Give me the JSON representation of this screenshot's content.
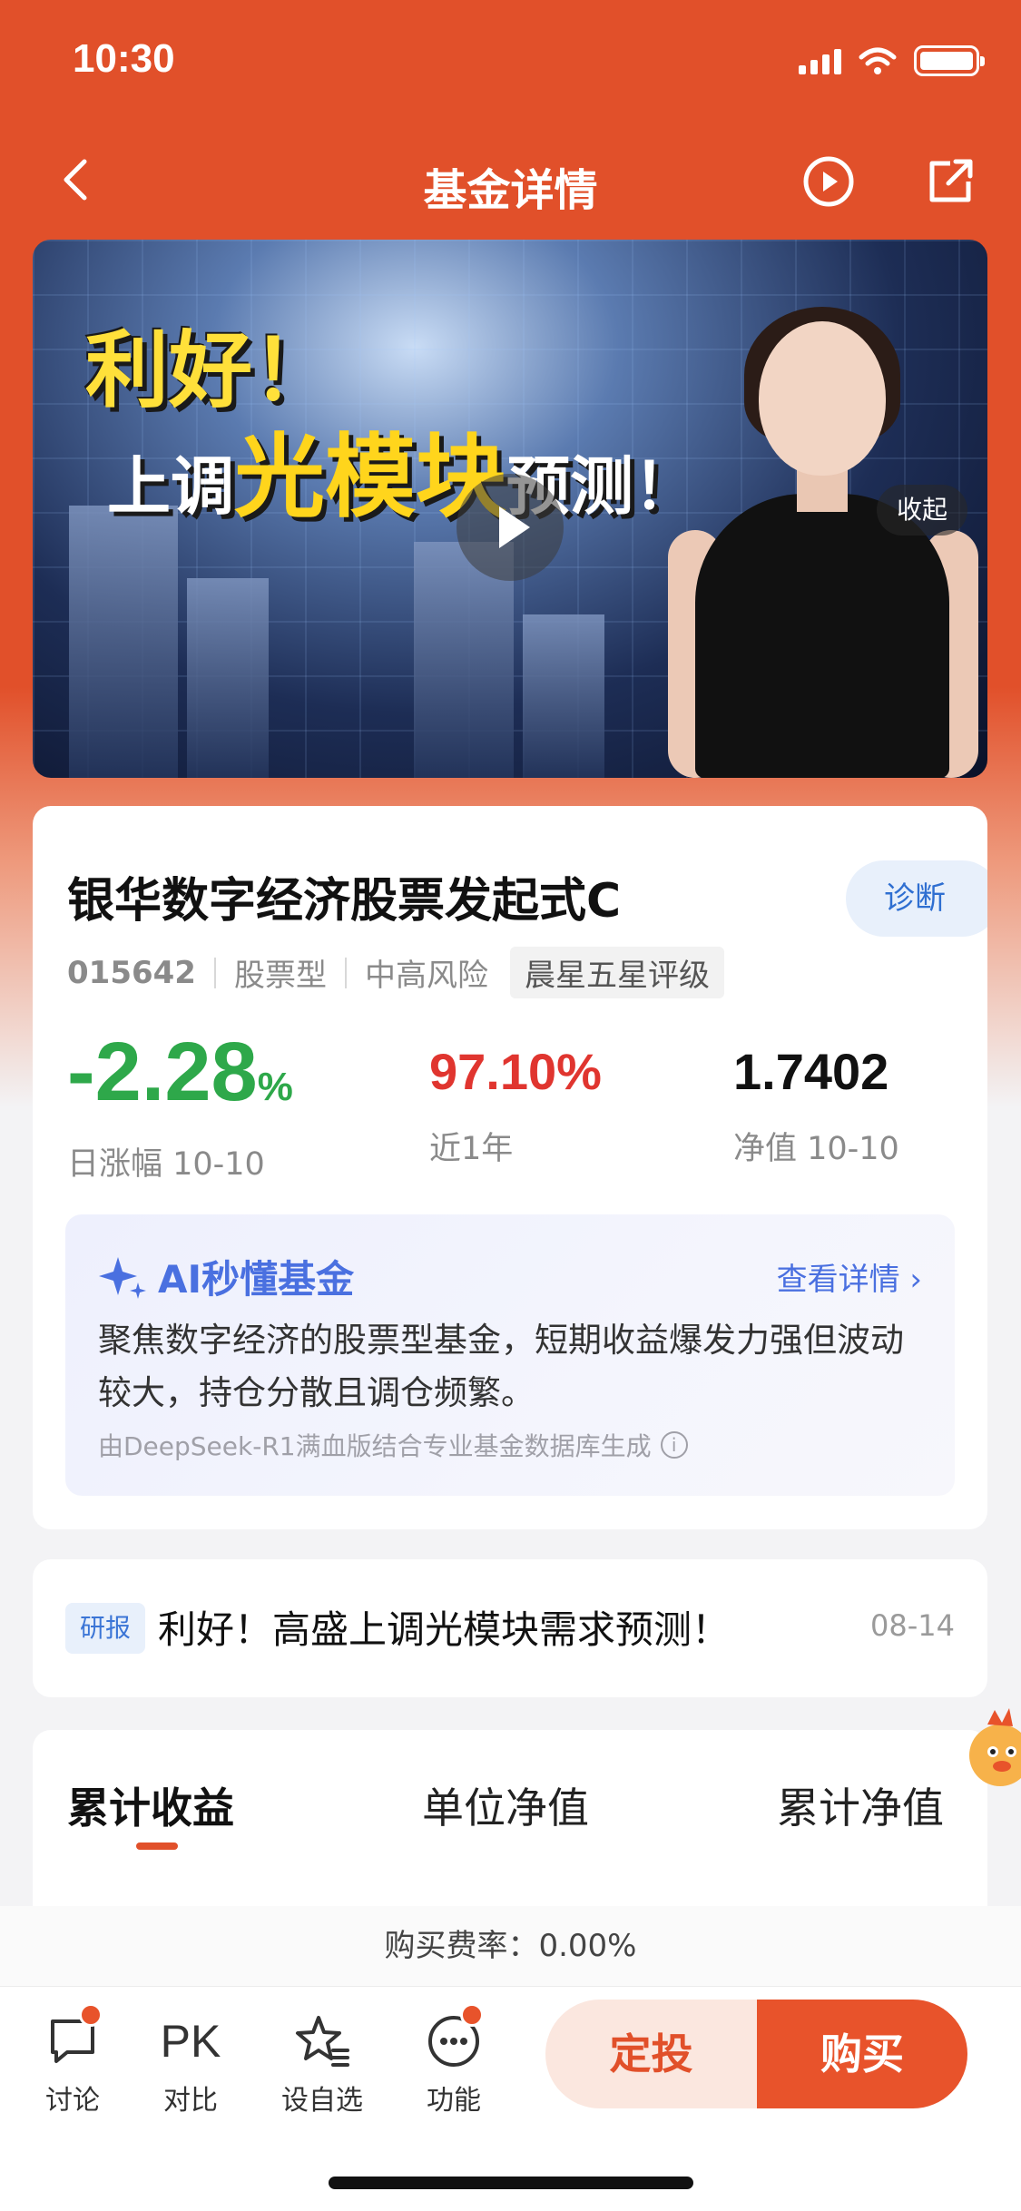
{
  "status_bar": {
    "time": "10:30"
  },
  "nav": {
    "title": "基金详情"
  },
  "video": {
    "headline_line1": "利好！",
    "headline_line2_pre": "上调",
    "headline_line2_highlight": "光模块",
    "headline_line2_post": "预测！",
    "collapse_label": "收起"
  },
  "fund": {
    "name": "银华数字经济股票发起式C",
    "diagnose_label": "诊断",
    "code": "015642",
    "type": "股票型",
    "risk": "中高风险",
    "rating": "晨星五星评级",
    "stats": [
      {
        "value": "-2.28",
        "unit": "%",
        "label": "日涨幅 10-10",
        "color": "#2ea84a"
      },
      {
        "value": "97.10%",
        "label": "近1年",
        "color": "#e0352f"
      },
      {
        "value": "1.7402",
        "label": "净值 10-10",
        "color": "#111111"
      }
    ]
  },
  "ai": {
    "title": "AI秒懂基金",
    "more_label": "查看详情",
    "description": "聚焦数字经济的股票型基金，短期收益爆发力强但波动较大，持仓分散且调仓频繁。",
    "source": "由DeepSeek-R1满血版结合专业基金数据库生成"
  },
  "research": {
    "tag": "研报",
    "text": "利好！高盛上调光模块需求预测！",
    "date": "08-14"
  },
  "chart_tabs": [
    "累计收益",
    "单位净值",
    "累计净值"
  ],
  "fee": {
    "text": "购买费率：0.00%"
  },
  "bottom_bar": {
    "items": [
      {
        "label": "讨论",
        "icon": "chat-bubble-icon"
      },
      {
        "label": "对比",
        "icon": "pk-icon",
        "glyph": "PK"
      },
      {
        "label": "设自选",
        "icon": "star-list-icon"
      },
      {
        "label": "功能",
        "icon": "more-dots-icon"
      }
    ],
    "fixed_invest_label": "定投",
    "buy_label": "购买"
  },
  "colors": {
    "brand": "#e1502a",
    "up": "#e0352f",
    "down": "#2ea84a",
    "ai_blue": "#4a70e0"
  }
}
